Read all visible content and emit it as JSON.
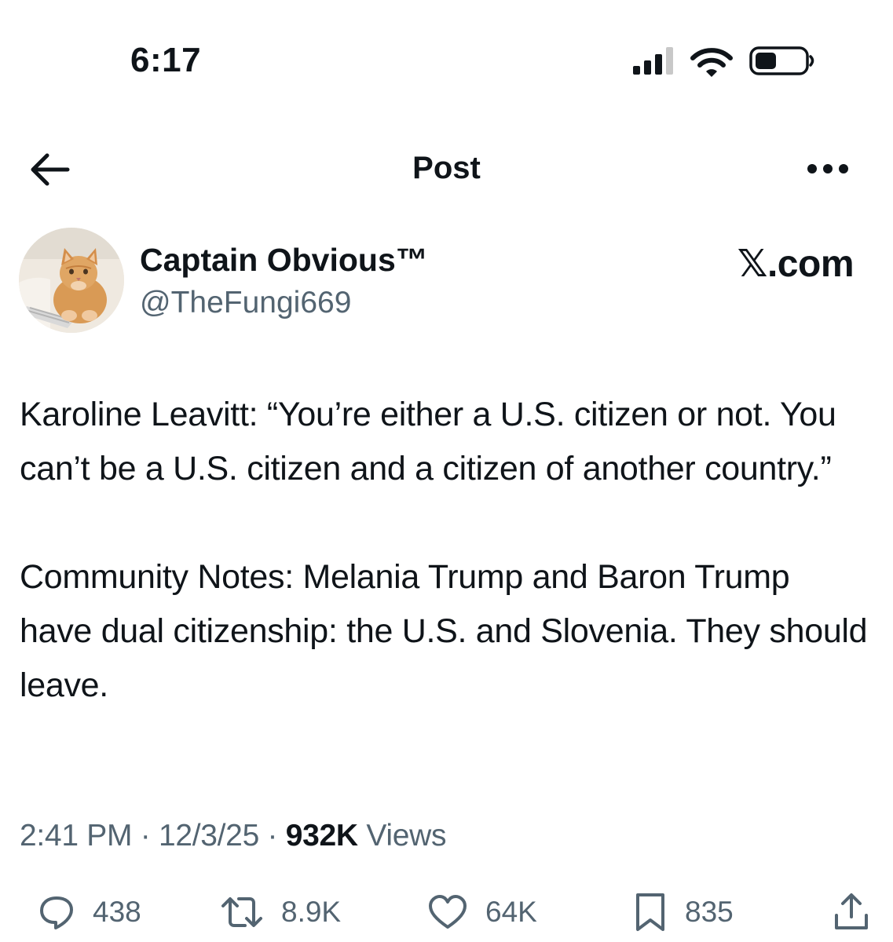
{
  "status_bar": {
    "time": "6:17",
    "signal_icon": "signal-bars-icon",
    "wifi_icon": "wifi-icon",
    "battery_icon": "battery-icon"
  },
  "nav": {
    "title": "Post",
    "back_icon": "back-arrow-icon",
    "more_icon": "more-dots-icon"
  },
  "author": {
    "display_name": "Captain Obvious™",
    "handle": "@TheFungi669",
    "avatar_icon": "cat-avatar"
  },
  "watermark": "𝕏.com",
  "post": {
    "paragraphs": [
      "Karoline Leavitt: “You’re either a U.S. citizen or not. You can’t be a U.S. citizen and a citizen of another country.”",
      "Community Notes: Melania Trump and Baron Trump have dual citizenship: the U.S. and Slovenia. They should leave."
    ],
    "time": "2:41 PM",
    "date": "12/3/25",
    "separator": "·",
    "views_count": "932K",
    "views_label": "Views"
  },
  "actions": {
    "replies": "438",
    "reposts": "8.9K",
    "likes": "64K",
    "bookmarks": "835"
  },
  "colors": {
    "text_primary": "#0f1419",
    "text_secondary": "#536471",
    "background": "#ffffff"
  }
}
